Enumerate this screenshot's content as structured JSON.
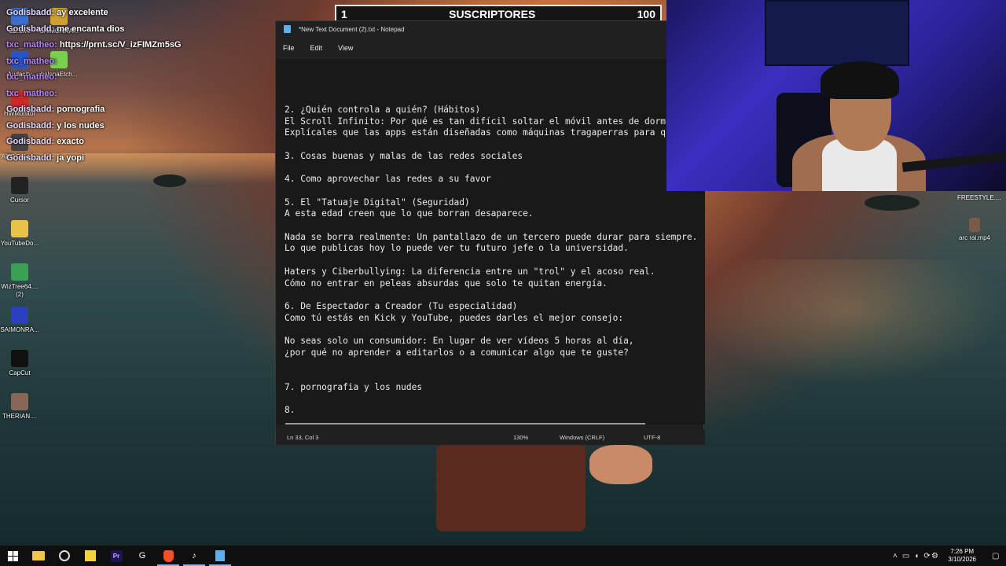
{
  "chat": [
    {
      "user": "Godisbadd:",
      "message": "ay excelente",
      "alt": false
    },
    {
      "user": "Godisbadd:",
      "message": "me encanta dios",
      "alt": false
    },
    {
      "user": "txc_matheo:",
      "message": "https://prnt.sc/V_izFIMZm5sG",
      "alt": true
    },
    {
      "user": "txc_matheo:",
      "message": "",
      "alt": true
    },
    {
      "user": "txc_matheo:",
      "message": "",
      "alt": true
    },
    {
      "user": "txc_matheo:",
      "message": "",
      "alt": true
    },
    {
      "user": "Godisbadd:",
      "message": "pornografia",
      "alt": false
    },
    {
      "user": "Godisbadd:",
      "message": "y los nudes",
      "alt": false
    },
    {
      "user": "Godisbadd:",
      "message": "exacto",
      "alt": false
    },
    {
      "user": "Godisbadd:",
      "message": "ja yopi",
      "alt": false
    }
  ],
  "subs": {
    "current": "1",
    "label": "SUSCRIPTORES",
    "goal": "100"
  },
  "desktop_icons": [
    {
      "label": "SE.Live",
      "icon": "app-icon"
    },
    {
      "label": "SAIMONRA...",
      "icon": "app-icon"
    },
    {
      "label": "Audacity",
      "icon": "audacity-icon"
    },
    {
      "label": "balenaEtch...",
      "icon": "balena-icon"
    },
    {
      "label": "HWMonitor",
      "icon": "hwmonitor-icon"
    },
    {
      "label": "ARC Raiders",
      "icon": "game-icon"
    },
    {
      "label": "Cursor",
      "icon": "cursor-app-icon"
    },
    {
      "label": "YouTubeDo...",
      "icon": "folder-icon"
    },
    {
      "label": "WizTree64.... (2)",
      "icon": "wiztree-icon"
    },
    {
      "label": "SAIMONRA...",
      "icon": "app-icon"
    },
    {
      "label": "CapCut",
      "icon": "capcut-icon"
    },
    {
      "label": "THERIAN....",
      "icon": "video-icon"
    }
  ],
  "right_desktop": {
    "freestyle": "FREESTYLE....",
    "arc_file": "arc rai.mp4"
  },
  "notepad": {
    "title": "*New Text Document (2).txt - Notepad",
    "menu": [
      "File",
      "Edit",
      "View"
    ],
    "lines": [
      "2. ¿Quién controla a quién? (Hábitos)",
      "El Scroll Infinito: Por qué es tan difícil soltar el móvil antes de dormi",
      "Explícales que las apps están diseñadas como máquinas tragaperras para qu",
      "",
      "3. Cosas buenas y malas de las redes sociales",
      "",
      "4. Como aprovechar las redes a su favor",
      "",
      "5. El \"Tatuaje Digital\" (Seguridad)",
      "A esta edad creen que lo que borran desaparece.",
      "",
      "Nada se borra realmente: Un pantallazo de un tercero puede durar para siempre.",
      "Lo que publicas hoy lo puede ver tu futuro jefe o la universidad.",
      "",
      "Haters y Ciberbullying: La diferencia entre un \"trol\" y el acoso real.",
      "Cómo no entrar en peleas absurdas que solo te quitan energía.",
      "",
      "6. De Espectador a Creador (Tu especialidad)",
      "Como tú estás en Kick y YouTube, puedes darles el mejor consejo:",
      "",
      "No seas solo un consumidor: En lugar de ver vídeos 5 horas al día,",
      "¿por qué no aprender a editarlos o a comunicar algo que te guste?",
      "",
      "",
      "7. pornografia y los nudes",
      "",
      "8."
    ],
    "status": {
      "position": "Ln 33, Col 3",
      "zoom": "130%",
      "line_ending": "Windows (CRLF)",
      "encoding": "UTF-8"
    }
  },
  "taskbar": {
    "items": [
      "start-icon",
      "file-explorer-icon",
      "chrome-icon",
      "sticky-notes-icon",
      "premiere-icon",
      "ghub-icon",
      "brave-icon",
      "tiktok-icon",
      "notepad-icon"
    ],
    "time": "7:26 PM",
    "date": "3/10/2026"
  }
}
